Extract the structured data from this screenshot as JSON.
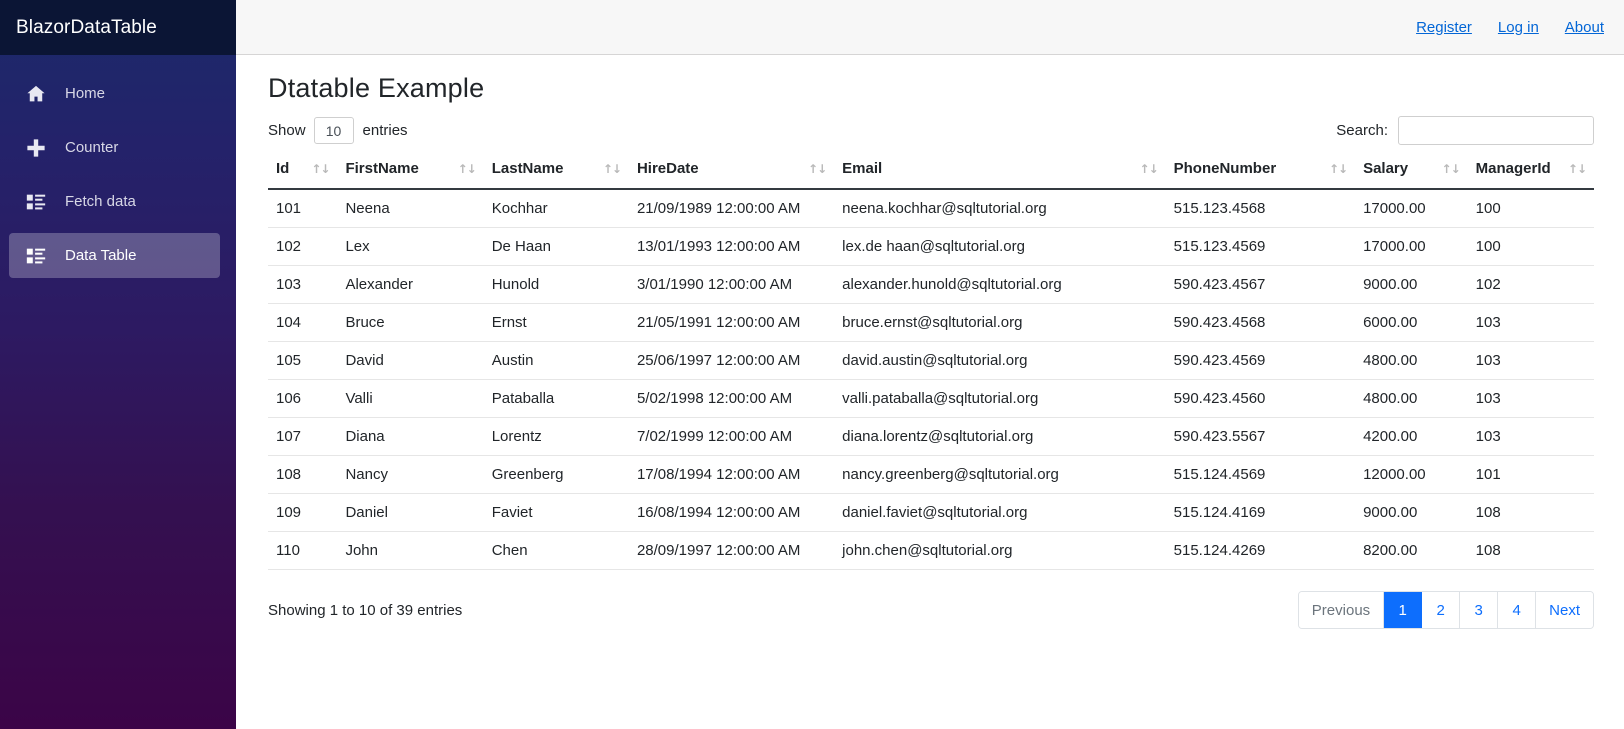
{
  "sidebar": {
    "brand": "BlazorDataTable",
    "items": [
      {
        "label": "Home",
        "icon": "home-icon",
        "active": false
      },
      {
        "label": "Counter",
        "icon": "plus-icon",
        "active": false
      },
      {
        "label": "Fetch data",
        "icon": "list-ul-icon",
        "active": false
      },
      {
        "label": "Data Table",
        "icon": "list-ul-icon",
        "active": true
      }
    ]
  },
  "topbar": {
    "links": [
      {
        "label": "Register"
      },
      {
        "label": "Log in"
      },
      {
        "label": "About"
      }
    ]
  },
  "main": {
    "page_title": "Dtatable Example",
    "controls": {
      "show_label": "Show",
      "entries_label": "entries",
      "entries_value": "10",
      "search_label": "Search:",
      "search_value": "",
      "search_placeholder": ""
    },
    "table": {
      "columns": [
        {
          "key": "id",
          "label": "Id",
          "sort_icon": "sort-updown-icon"
        },
        {
          "key": "firstname",
          "label": "FirstName",
          "sort_icon": "sort-updown-icon"
        },
        {
          "key": "lastname",
          "label": "LastName",
          "sort_icon": "sort-updown-icon"
        },
        {
          "key": "hiredate",
          "label": "HireDate",
          "sort_icon": "sort-updown-icon"
        },
        {
          "key": "email",
          "label": "Email",
          "sort_icon": "sort-updown-icon"
        },
        {
          "key": "phonenumber",
          "label": "PhoneNumber",
          "sort_icon": "sort-updown-icon"
        },
        {
          "key": "salary",
          "label": "Salary",
          "sort_icon": "sort-updown-icon"
        },
        {
          "key": "managerid",
          "label": "ManagerId",
          "sort_icon": "sort-updown-icon"
        }
      ],
      "rows": [
        [
          "101",
          "Neena",
          "Kochhar",
          "21/09/1989 12:00:00 AM",
          "neena.kochhar@sqltutorial.org",
          "515.123.4568",
          "17000.00",
          "100"
        ],
        [
          "102",
          "Lex",
          "De Haan",
          "13/01/1993 12:00:00 AM",
          "lex.de haan@sqltutorial.org",
          "515.123.4569",
          "17000.00",
          "100"
        ],
        [
          "103",
          "Alexander",
          "Hunold",
          "3/01/1990 12:00:00 AM",
          "alexander.hunold@sqltutorial.org",
          "590.423.4567",
          "9000.00",
          "102"
        ],
        [
          "104",
          "Bruce",
          "Ernst",
          "21/05/1991 12:00:00 AM",
          "bruce.ernst@sqltutorial.org",
          "590.423.4568",
          "6000.00",
          "103"
        ],
        [
          "105",
          "David",
          "Austin",
          "25/06/1997 12:00:00 AM",
          "david.austin@sqltutorial.org",
          "590.423.4569",
          "4800.00",
          "103"
        ],
        [
          "106",
          "Valli",
          "Pataballa",
          "5/02/1998 12:00:00 AM",
          "valli.pataballa@sqltutorial.org",
          "590.423.4560",
          "4800.00",
          "103"
        ],
        [
          "107",
          "Diana",
          "Lorentz",
          "7/02/1999 12:00:00 AM",
          "diana.lorentz@sqltutorial.org",
          "590.423.5567",
          "4200.00",
          "103"
        ],
        [
          "108",
          "Nancy",
          "Greenberg",
          "17/08/1994 12:00:00 AM",
          "nancy.greenberg@sqltutorial.org",
          "515.124.4569",
          "12000.00",
          "101"
        ],
        [
          "109",
          "Daniel",
          "Faviet",
          "16/08/1994 12:00:00 AM",
          "daniel.faviet@sqltutorial.org",
          "515.124.4169",
          "9000.00",
          "108"
        ],
        [
          "110",
          "John",
          "Chen",
          "28/09/1997 12:00:00 AM",
          "john.chen@sqltutorial.org",
          "515.124.4269",
          "8200.00",
          "108"
        ]
      ]
    },
    "footer": {
      "showing_info": "Showing 1 to 10 of 39 entries",
      "pagination": [
        {
          "label": "Previous",
          "state": "disabled"
        },
        {
          "label": "1",
          "state": "active"
        },
        {
          "label": "2",
          "state": "normal"
        },
        {
          "label": "3",
          "state": "normal"
        },
        {
          "label": "4",
          "state": "normal"
        },
        {
          "label": "Next",
          "state": "normal"
        }
      ]
    }
  },
  "colors": {
    "accent": "#0d6efd",
    "link": "#0366d6",
    "sidebar_top": "#1b2a6b",
    "sidebar_bottom": "#3b0447",
    "brand_bar": "#0b1535"
  }
}
